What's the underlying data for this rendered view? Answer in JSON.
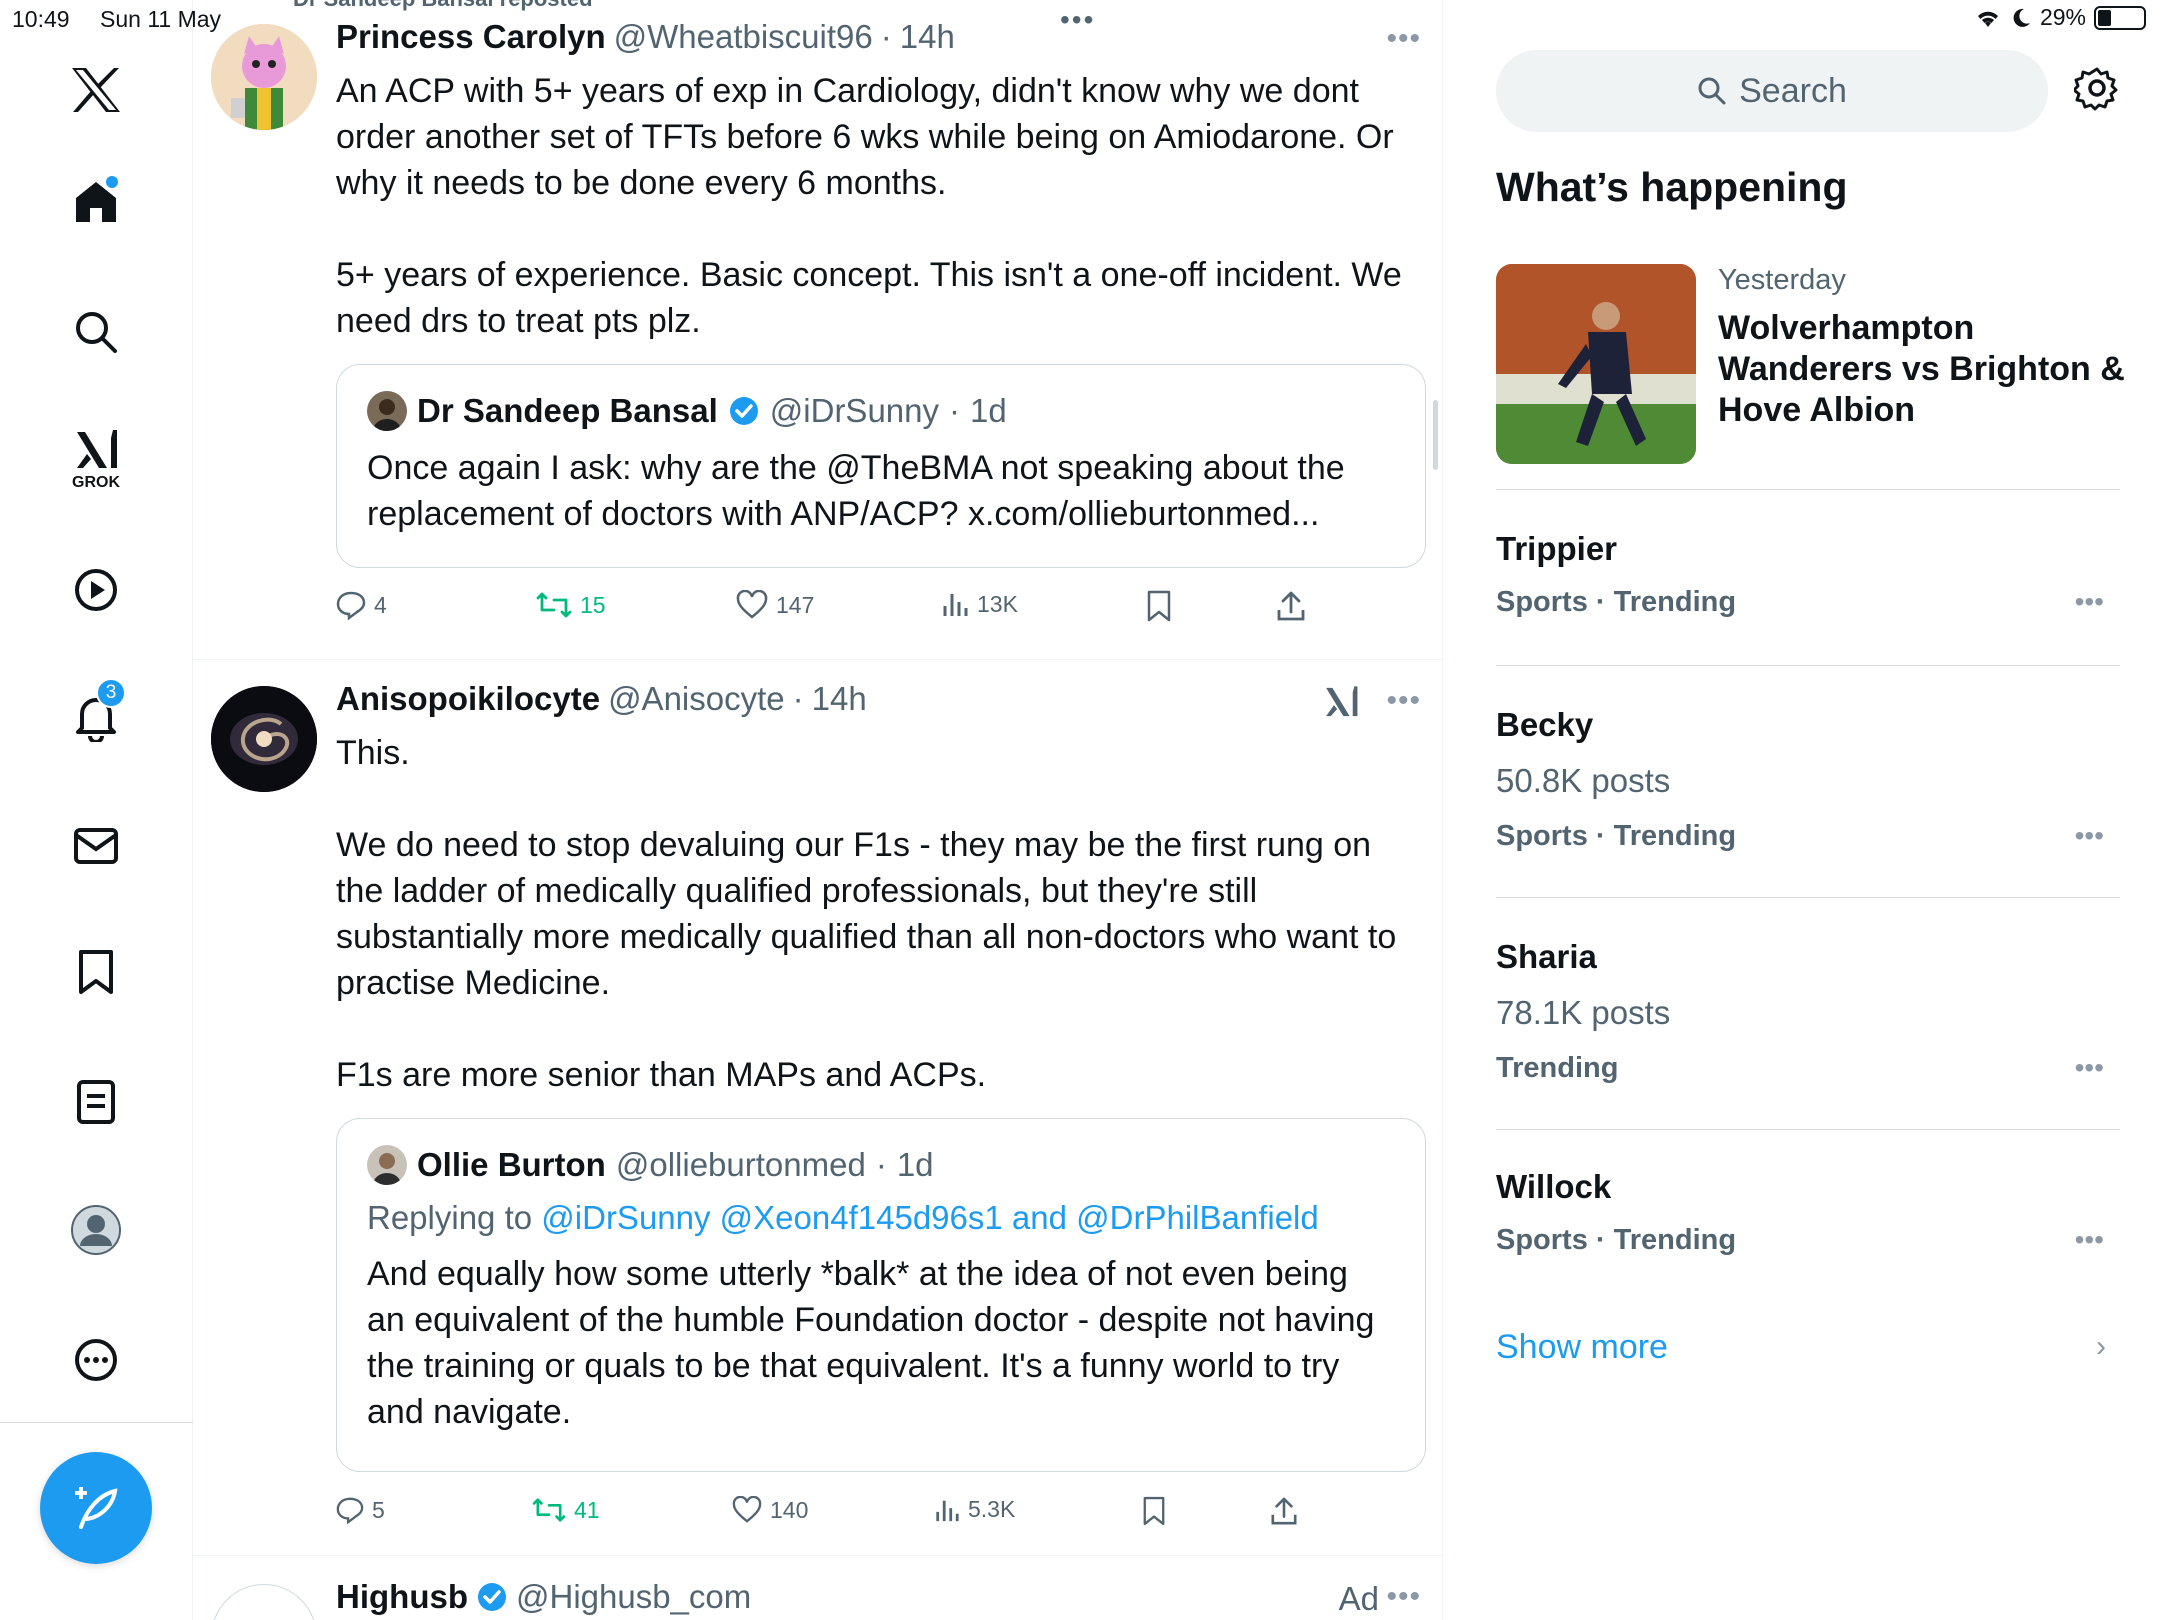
{
  "status_bar": {
    "time": "10:49",
    "date": "Sun 11 May",
    "battery": "29%",
    "battery_level": 0.29
  },
  "nav": {
    "items": [
      "home",
      "explore",
      "grok",
      "video",
      "notifications",
      "messages",
      "bookmarks",
      "lists",
      "profile",
      "more"
    ],
    "grok_label": "GROK",
    "notifications_badge": "3"
  },
  "feed": {
    "repost_header": "Dr Sandeep Bansal reposted",
    "tweets": [
      {
        "name": "Princess Carolyn",
        "handle": "@Wheatbiscuit96",
        "sep": "·",
        "time": "14h",
        "paragraphs": [
          "An ACP with 5+ years of exp in Cardiology, didn't know why we dont order another set of TFTs before 6 wks while being on Amiodarone. Or why it needs to be done every 6 months.",
          "5+ years of experience. Basic concept. This isn't a one-off incident. We need drs to treat pts plz."
        ],
        "quote": {
          "name": "Dr Sandeep Bansal",
          "handle": "@iDrSunny",
          "sep": "·",
          "time": "1d",
          "text": "Once again I ask: why are the @TheBMA not speaking about the replacement of doctors with ANP/ACP? x.com/ollieburtonmed..."
        },
        "stats": {
          "replies": "4",
          "reposts": "15",
          "likes": "147",
          "views": "13K"
        }
      },
      {
        "name": "Anisopoikilocyte",
        "handle": "@Anisocyte",
        "sep": "·",
        "time": "14h",
        "paragraphs": [
          "This.",
          "We do need to stop devaluing our F1s - they may be the first rung on the ladder of medically qualified professionals, but they're still substantially more medically qualified than all non-doctors who want to practise Medicine.",
          "F1s are more senior than MAPs and ACPs."
        ],
        "quote": {
          "name": "Ollie Burton",
          "handle": "@ollieburtonmed",
          "sep": "·",
          "time": "1d",
          "reply_prefix": "Replying to",
          "reply_targets": "@iDrSunny @Xeon4f145d96s1 and @DrPhilBanfield",
          "text": "And equally how some utterly *balk* at the idea of not even being an equivalent of the humble Foundation doctor - despite not having the training or quals to be that equivalent. It's a funny world to try and navigate."
        },
        "stats": {
          "replies": "5",
          "reposts": "41",
          "likes": "140",
          "views": "5.3K"
        }
      },
      {
        "name": "Highusb",
        "handle": "@Highusb_com",
        "ad_label": "Ad"
      }
    ]
  },
  "sidebar": {
    "search_placeholder": "Search",
    "section_title": "What’s happening",
    "news": {
      "meta": "Yesterday",
      "title": "Wolverhampton Wanderers vs Brighton & Hove Albion"
    },
    "trends": [
      {
        "name": "Trippier",
        "posts": "",
        "category": "Sports · Trending"
      },
      {
        "name": "Becky",
        "posts": "50.8K posts",
        "category": "Sports · Trending"
      },
      {
        "name": "Sharia",
        "posts": "78.1K posts",
        "category": "Trending"
      },
      {
        "name": "Willock",
        "posts": "",
        "category": "Sports · Trending"
      }
    ],
    "show_more": "Show more"
  },
  "colors": {
    "accent": "#1d9bf0",
    "repost": "#00ba7c",
    "secondary_text": "#536471"
  }
}
